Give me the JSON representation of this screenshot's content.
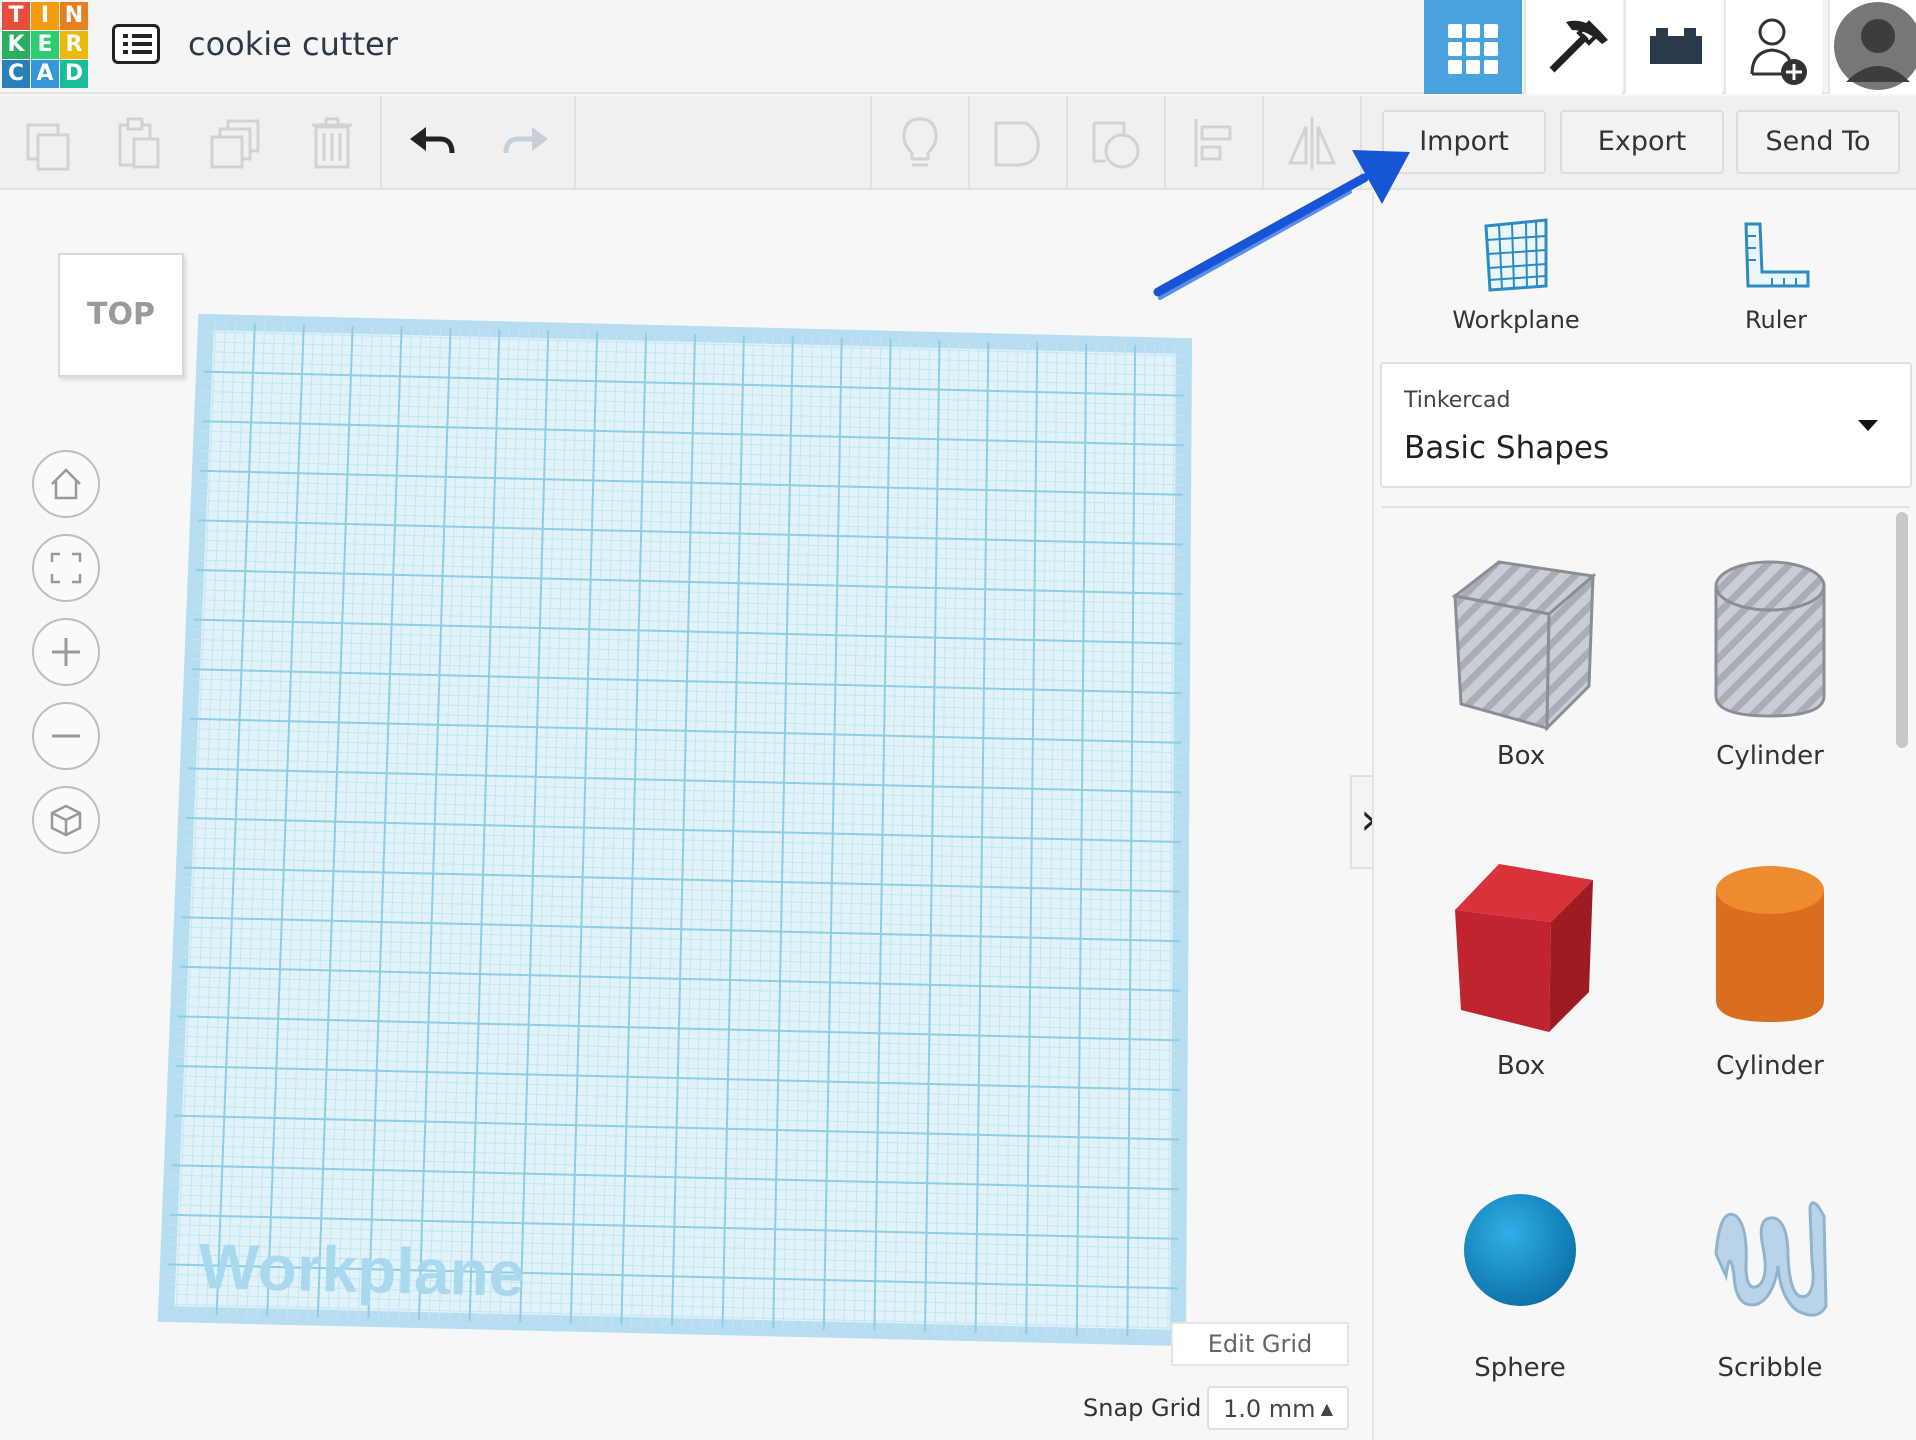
{
  "logo": {
    "letters": [
      "T",
      "I",
      "N",
      "K",
      "E",
      "R",
      "C",
      "A",
      "D"
    ],
    "colors": [
      "#e84c3d",
      "#f39c12",
      "#e67e22",
      "#27ae60",
      "#2ecc71",
      "#f1c40f",
      "#2980b9",
      "#3498db",
      "#1abc9c"
    ]
  },
  "document": {
    "title": "cookie cutter"
  },
  "header": {
    "accent": "#4aa3df",
    "buttons": [
      "grid-view-icon",
      "pickaxe-icon",
      "bricks-icon",
      "add-user-icon"
    ]
  },
  "toolbar": {
    "left_tools": [
      "copy-icon",
      "paste-icon",
      "duplicate-icon",
      "delete-icon",
      "undo-icon",
      "redo-icon"
    ],
    "right_tools": [
      "notes-icon",
      "show-all-icon",
      "hide-icon",
      "align-icon",
      "mirror-icon"
    ],
    "import_label": "Import",
    "export_label": "Export",
    "send_to_label": "Send To"
  },
  "canvas": {
    "viewcube_label": "TOP",
    "workplane_watermark": "Workplane",
    "edit_grid_label": "Edit Grid",
    "snap_grid_label": "Snap Grid",
    "snap_grid_value": "1.0 mm"
  },
  "panel": {
    "tools": [
      {
        "label": "Workplane"
      },
      {
        "label": "Ruler"
      }
    ],
    "shape_category": "Tinkercad",
    "shape_library": "Basic Shapes",
    "shapes": [
      {
        "label": "Box"
      },
      {
        "label": "Cylinder"
      },
      {
        "label": "Box"
      },
      {
        "label": "Cylinder"
      },
      {
        "label": "Sphere"
      },
      {
        "label": "Scribble"
      }
    ]
  }
}
